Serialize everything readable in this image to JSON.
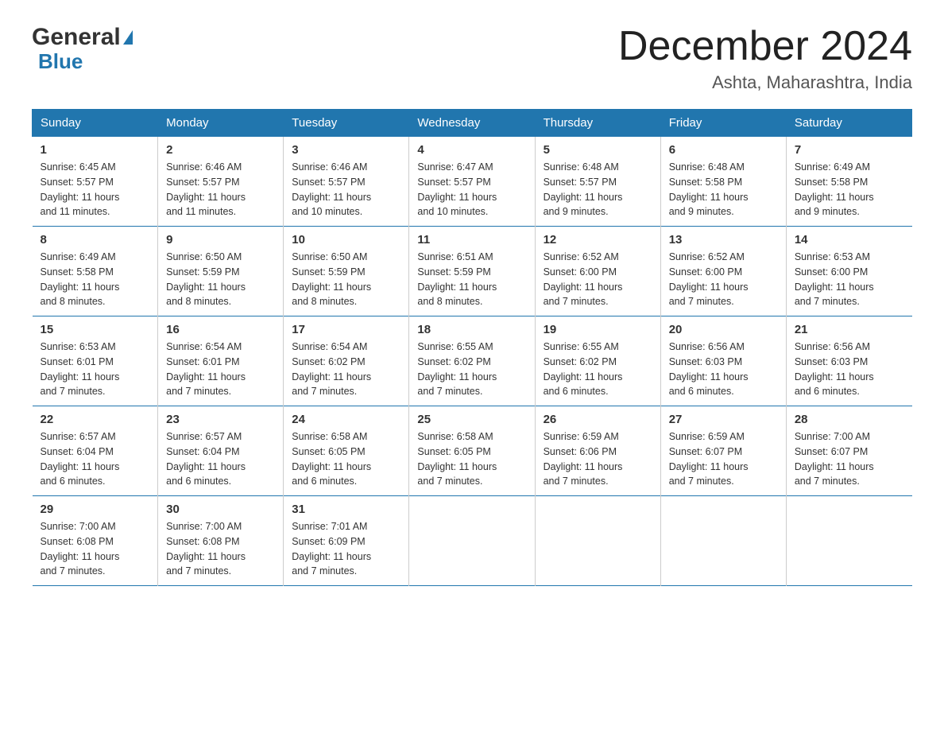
{
  "logo": {
    "general": "General",
    "blue": "Blue",
    "arrow": "▶"
  },
  "title": "December 2024",
  "location": "Ashta, Maharashtra, India",
  "days_header": [
    "Sunday",
    "Monday",
    "Tuesday",
    "Wednesday",
    "Thursday",
    "Friday",
    "Saturday"
  ],
  "weeks": [
    [
      {
        "day": "1",
        "sunrise": "6:45 AM",
        "sunset": "5:57 PM",
        "daylight": "11 hours and 11 minutes."
      },
      {
        "day": "2",
        "sunrise": "6:46 AM",
        "sunset": "5:57 PM",
        "daylight": "11 hours and 11 minutes."
      },
      {
        "day": "3",
        "sunrise": "6:46 AM",
        "sunset": "5:57 PM",
        "daylight": "11 hours and 10 minutes."
      },
      {
        "day": "4",
        "sunrise": "6:47 AM",
        "sunset": "5:57 PM",
        "daylight": "11 hours and 10 minutes."
      },
      {
        "day": "5",
        "sunrise": "6:48 AM",
        "sunset": "5:57 PM",
        "daylight": "11 hours and 9 minutes."
      },
      {
        "day": "6",
        "sunrise": "6:48 AM",
        "sunset": "5:58 PM",
        "daylight": "11 hours and 9 minutes."
      },
      {
        "day": "7",
        "sunrise": "6:49 AM",
        "sunset": "5:58 PM",
        "daylight": "11 hours and 9 minutes."
      }
    ],
    [
      {
        "day": "8",
        "sunrise": "6:49 AM",
        "sunset": "5:58 PM",
        "daylight": "11 hours and 8 minutes."
      },
      {
        "day": "9",
        "sunrise": "6:50 AM",
        "sunset": "5:59 PM",
        "daylight": "11 hours and 8 minutes."
      },
      {
        "day": "10",
        "sunrise": "6:50 AM",
        "sunset": "5:59 PM",
        "daylight": "11 hours and 8 minutes."
      },
      {
        "day": "11",
        "sunrise": "6:51 AM",
        "sunset": "5:59 PM",
        "daylight": "11 hours and 8 minutes."
      },
      {
        "day": "12",
        "sunrise": "6:52 AM",
        "sunset": "6:00 PM",
        "daylight": "11 hours and 7 minutes."
      },
      {
        "day": "13",
        "sunrise": "6:52 AM",
        "sunset": "6:00 PM",
        "daylight": "11 hours and 7 minutes."
      },
      {
        "day": "14",
        "sunrise": "6:53 AM",
        "sunset": "6:00 PM",
        "daylight": "11 hours and 7 minutes."
      }
    ],
    [
      {
        "day": "15",
        "sunrise": "6:53 AM",
        "sunset": "6:01 PM",
        "daylight": "11 hours and 7 minutes."
      },
      {
        "day": "16",
        "sunrise": "6:54 AM",
        "sunset": "6:01 PM",
        "daylight": "11 hours and 7 minutes."
      },
      {
        "day": "17",
        "sunrise": "6:54 AM",
        "sunset": "6:02 PM",
        "daylight": "11 hours and 7 minutes."
      },
      {
        "day": "18",
        "sunrise": "6:55 AM",
        "sunset": "6:02 PM",
        "daylight": "11 hours and 7 minutes."
      },
      {
        "day": "19",
        "sunrise": "6:55 AM",
        "sunset": "6:02 PM",
        "daylight": "11 hours and 6 minutes."
      },
      {
        "day": "20",
        "sunrise": "6:56 AM",
        "sunset": "6:03 PM",
        "daylight": "11 hours and 6 minutes."
      },
      {
        "day": "21",
        "sunrise": "6:56 AM",
        "sunset": "6:03 PM",
        "daylight": "11 hours and 6 minutes."
      }
    ],
    [
      {
        "day": "22",
        "sunrise": "6:57 AM",
        "sunset": "6:04 PM",
        "daylight": "11 hours and 6 minutes."
      },
      {
        "day": "23",
        "sunrise": "6:57 AM",
        "sunset": "6:04 PM",
        "daylight": "11 hours and 6 minutes."
      },
      {
        "day": "24",
        "sunrise": "6:58 AM",
        "sunset": "6:05 PM",
        "daylight": "11 hours and 6 minutes."
      },
      {
        "day": "25",
        "sunrise": "6:58 AM",
        "sunset": "6:05 PM",
        "daylight": "11 hours and 7 minutes."
      },
      {
        "day": "26",
        "sunrise": "6:59 AM",
        "sunset": "6:06 PM",
        "daylight": "11 hours and 7 minutes."
      },
      {
        "day": "27",
        "sunrise": "6:59 AM",
        "sunset": "6:07 PM",
        "daylight": "11 hours and 7 minutes."
      },
      {
        "day": "28",
        "sunrise": "7:00 AM",
        "sunset": "6:07 PM",
        "daylight": "11 hours and 7 minutes."
      }
    ],
    [
      {
        "day": "29",
        "sunrise": "7:00 AM",
        "sunset": "6:08 PM",
        "daylight": "11 hours and 7 minutes."
      },
      {
        "day": "30",
        "sunrise": "7:00 AM",
        "sunset": "6:08 PM",
        "daylight": "11 hours and 7 minutes."
      },
      {
        "day": "31",
        "sunrise": "7:01 AM",
        "sunset": "6:09 PM",
        "daylight": "11 hours and 7 minutes."
      },
      null,
      null,
      null,
      null
    ]
  ],
  "labels": {
    "sunrise": "Sunrise:",
    "sunset": "Sunset:",
    "daylight": "Daylight:"
  }
}
